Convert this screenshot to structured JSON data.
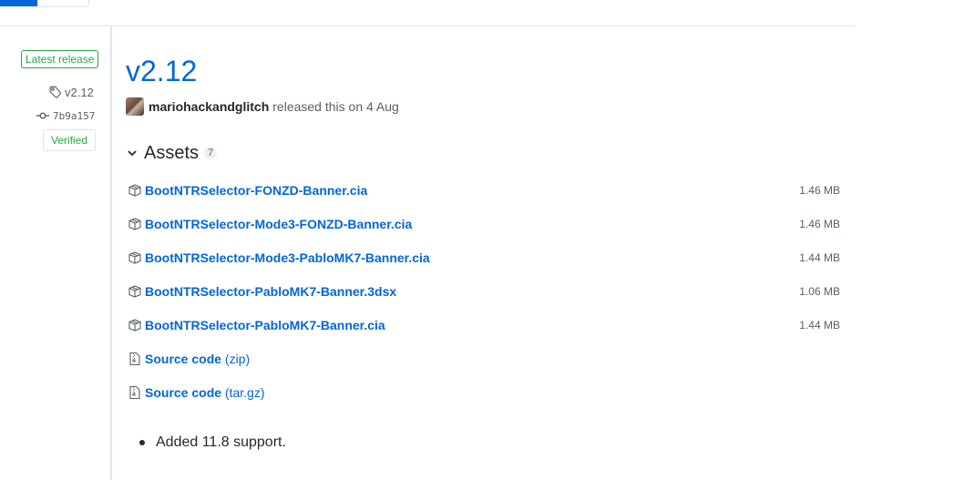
{
  "sidebar": {
    "latest_badge": "Latest release",
    "tag": "v2.12",
    "commit": "7b9a157",
    "verified": "Verified"
  },
  "release": {
    "title": "v2.12",
    "author": "mariohackandglitch",
    "released_text": "released this on 4 Aug"
  },
  "assets": {
    "title": "Assets",
    "count": "7",
    "files": [
      {
        "name": "BootNTRSelector-FONZD-Banner.cia",
        "size": "1.46 MB"
      },
      {
        "name": "BootNTRSelector-Mode3-FONZD-Banner.cia",
        "size": "1.46 MB"
      },
      {
        "name": "BootNTRSelector-Mode3-PabloMK7-Banner.cia",
        "size": "1.44 MB"
      },
      {
        "name": "BootNTRSelector-PabloMK7-Banner.3dsx",
        "size": "1.06 MB"
      },
      {
        "name": "BootNTRSelector-PabloMK7-Banner.cia",
        "size": "1.44 MB"
      }
    ],
    "source": [
      {
        "label": "Source code",
        "format": "(zip)"
      },
      {
        "label": "Source code",
        "format": "(tar.gz)"
      }
    ]
  },
  "notes": [
    "Added 11.8 support."
  ],
  "icons": {
    "tag": "tag-icon",
    "commit": "git-commit-icon",
    "package": "package-icon",
    "file_zip": "file-zip-icon",
    "chevron": "chevron-down-icon"
  },
  "colors": {
    "link": "#0366d6",
    "verified": "#28a745",
    "text": "#24292e",
    "muted": "#586069"
  }
}
